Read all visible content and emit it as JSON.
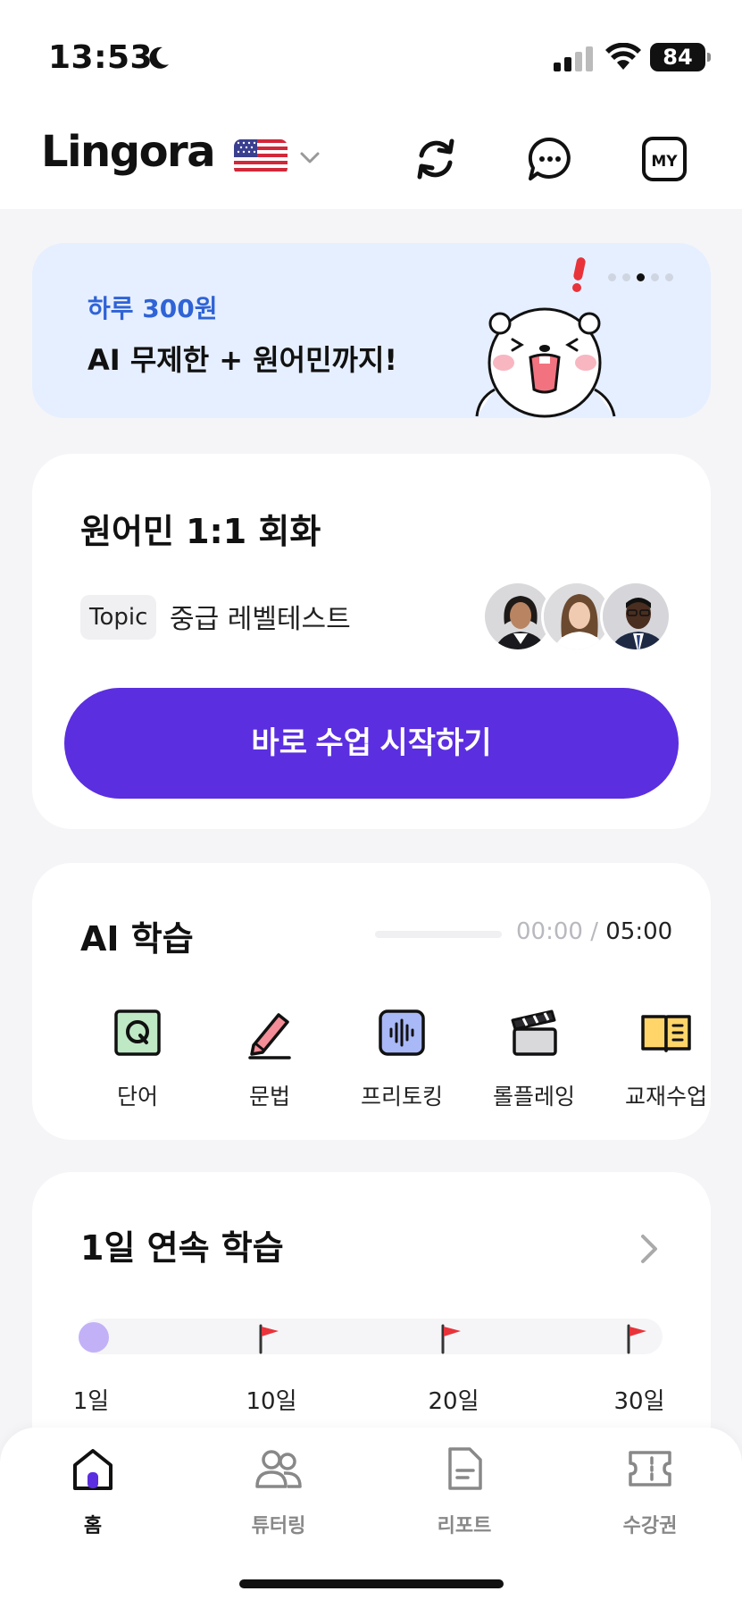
{
  "status_bar": {
    "time": "13:53",
    "battery": "84"
  },
  "header": {
    "logo": "Lingora",
    "language_flag": "us-flag-icon"
  },
  "banner": {
    "subtitle": "하루 300원",
    "title": "AI 무제한 + 원어민까지!",
    "page_count": 5,
    "active_page": 2
  },
  "native_class": {
    "title": "원어민 1:1 회화",
    "topic_tag": "Topic",
    "topic": "중급 레벨테스트",
    "cta": "바로 수업 시작하기"
  },
  "ai_learning": {
    "title": "AI 학습",
    "timer_current": "00:00",
    "timer_separator": "/",
    "timer_total": "05:00",
    "progress": 0,
    "items": [
      {
        "label": "단어",
        "icon": "q-card-icon"
      },
      {
        "label": "문법",
        "icon": "pencil-icon"
      },
      {
        "label": "프리토킹",
        "icon": "voice-wave-icon"
      },
      {
        "label": "롤플레잉",
        "icon": "clapperboard-icon"
      },
      {
        "label": "교재수업",
        "icon": "book-icon"
      }
    ]
  },
  "streak": {
    "title": "1일 연속 학습",
    "milestones": [
      "1일",
      "10일",
      "20일",
      "30일"
    ]
  },
  "bottom_nav": {
    "items": [
      {
        "label": "홈",
        "icon": "home-icon"
      },
      {
        "label": "튜터링",
        "icon": "users-icon"
      },
      {
        "label": "리포트",
        "icon": "report-icon"
      },
      {
        "label": "수강권",
        "icon": "ticket-icon"
      }
    ]
  },
  "colors": {
    "accent": "#5b2ee0",
    "banner_bg": "#e6efff",
    "banner_sub": "#2f63d6",
    "streak_start": "#c3b1f7",
    "flag_red": "#e8333a"
  }
}
